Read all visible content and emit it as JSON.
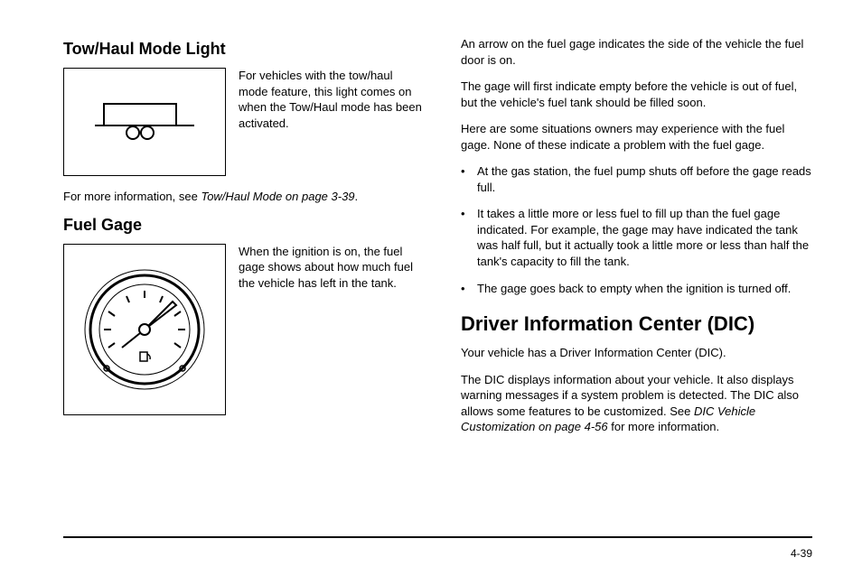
{
  "left": {
    "towHaul": {
      "heading": "Tow/Haul Mode Light",
      "desc": "For vehicles with the tow/haul mode feature, this light comes on when the Tow/Haul mode has been activated.",
      "more_pre": "For more information, see ",
      "more_ref": "Tow/Haul Mode on page 3-39",
      "more_post": "."
    },
    "fuelGage": {
      "heading": "Fuel Gage",
      "desc": "When the ignition is on, the fuel gage shows about how much fuel the vehicle has left in the tank."
    }
  },
  "right": {
    "p1": "An arrow on the fuel gage indicates the side of the vehicle the fuel door is on.",
    "p2": "The gage will first indicate empty before the vehicle is out of fuel, but the vehicle's fuel tank should be filled soon.",
    "p3": "Here are some situations owners may experience with the fuel gage. None of these indicate a problem with the fuel gage.",
    "bullets": [
      "At the gas station, the fuel pump shuts off before the gage reads full.",
      "It takes a little more or less fuel to fill up than the fuel gage indicated. For example, the gage may have indicated the tank was half full, but it actually took a little more or less than half the tank's capacity to fill the tank.",
      "The gage goes back to empty when the ignition is turned off."
    ],
    "dic": {
      "heading": "Driver Information Center (DIC)",
      "p1": "Your vehicle has a Driver Information Center (DIC).",
      "p2_pre": "The DIC displays information about your vehicle. It also displays warning messages if a system problem is detected. The DIC also allows some features to be customized. See ",
      "p2_ref": "DIC Vehicle Customization on page 4-56",
      "p2_post": " for more information."
    }
  },
  "pageNumber": "4-39"
}
